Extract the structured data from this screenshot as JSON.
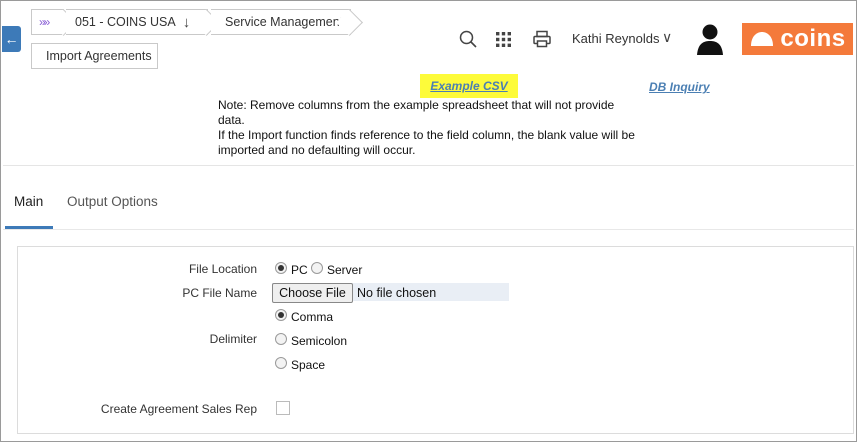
{
  "breadcrumb": {
    "home_glyph": "»»",
    "company": "051 - COINS USA",
    "module": "Service Management",
    "page": "Import Agreements"
  },
  "header": {
    "user_name": "Kathi Reynolds",
    "logo_text": "coins",
    "logo_color": "#f47a3b"
  },
  "links": {
    "example_csv": "Example CSV",
    "db_inquiry": "DB Inquiry"
  },
  "note": {
    "line1": "Note: Remove columns from the example spreadsheet that will not provide data.",
    "line2": "If the Import function finds reference to the field column, the blank value will be imported and no defaulting will occur."
  },
  "tabs": [
    {
      "label": "Main",
      "active": true
    },
    {
      "label": "Output Options",
      "active": false
    }
  ],
  "form": {
    "file_location_label": "File Location",
    "file_location_options": [
      {
        "label": "PC",
        "selected": true
      },
      {
        "label": "Server",
        "selected": false
      }
    ],
    "pc_file_name_label": "PC File Name",
    "choose_file_button": "Choose File",
    "file_status": "No file chosen",
    "delimiter_label": "Delimiter",
    "delimiter_options": [
      {
        "label": "Comma",
        "selected": true
      },
      {
        "label": "Semicolon",
        "selected": false
      },
      {
        "label": "Space",
        "selected": false
      }
    ],
    "create_sales_rep_label": "Create Agreement Sales Rep",
    "create_sales_rep_checked": false
  },
  "colors": {
    "accent": "#3d7ab8",
    "highlight": "#fdfb3a",
    "link": "#4b7fb3"
  }
}
